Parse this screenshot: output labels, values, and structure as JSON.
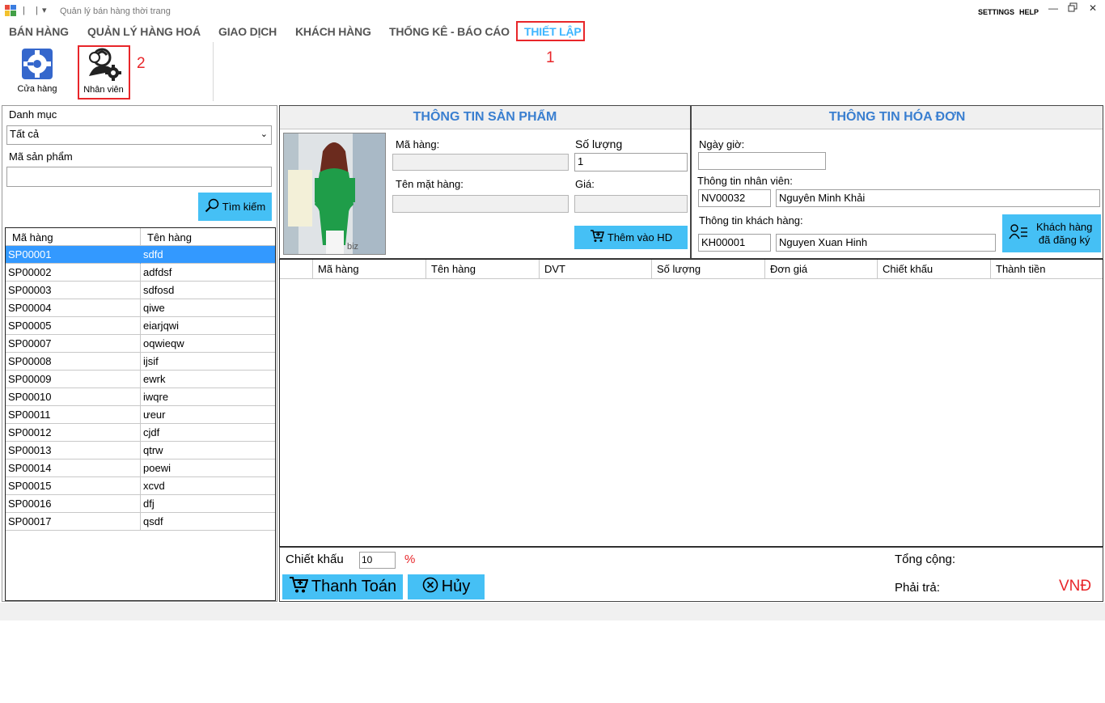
{
  "window": {
    "title": "Quản lý bán hàng thời trang",
    "settings": "SETTINGS",
    "help": "HELP"
  },
  "menu": {
    "tabs": [
      {
        "label": "BÁN HÀNG"
      },
      {
        "label": "QUẢN LÝ HÀNG HOÁ"
      },
      {
        "label": "GIAO DỊCH"
      },
      {
        "label": "KHÁCH HÀNG"
      },
      {
        "label": "THỐNG KÊ - BÁO CÁO"
      },
      {
        "label": "THIẾT LẬP"
      }
    ],
    "active_tab": "THIẾT LẬP"
  },
  "ribbon": {
    "store_label": "Cửa hàng",
    "staff_label": "Nhân viên"
  },
  "annotations": {
    "marker1": "1",
    "marker2": "2",
    "color": "#e8262a"
  },
  "filter": {
    "category_label": "Danh mục",
    "category_value": "Tất cả",
    "product_code_label": "Mã sản phẩm",
    "product_code_value": "",
    "search_button": "Tìm kiếm"
  },
  "product_list": {
    "columns": [
      "Mã hàng",
      "Tên hàng"
    ],
    "rows": [
      {
        "code": "SP00001",
        "name": "sdfd"
      },
      {
        "code": "SP00002",
        "name": "adfdsf"
      },
      {
        "code": "SP00003",
        "name": "sdfosd"
      },
      {
        "code": "SP00004",
        "name": "qiwe"
      },
      {
        "code": "SP00005",
        "name": "eiarjqwi"
      },
      {
        "code": "SP00007",
        "name": "oqwieqw"
      },
      {
        "code": "SP00008",
        "name": "ijsif"
      },
      {
        "code": "SP00009",
        "name": "ewrk"
      },
      {
        "code": "SP00010",
        "name": "iwqre"
      },
      {
        "code": "SP00011",
        "name": "ưeur"
      },
      {
        "code": "SP00012",
        "name": "cjdf"
      },
      {
        "code": "SP00013",
        "name": "qtrw"
      },
      {
        "code": "SP00014",
        "name": "poewi"
      },
      {
        "code": "SP00015",
        "name": "xcvd"
      },
      {
        "code": "SP00016",
        "name": "dfj"
      },
      {
        "code": "SP00017",
        "name": "qsdf"
      }
    ],
    "selected_code": "SP00001"
  },
  "product_info": {
    "header": "THÔNG TIN SẢN PHẨM",
    "code_label": "Mã hàng:",
    "code_value": "",
    "qty_label": "Số lượng",
    "qty_value": "1",
    "name_label": "Tên mặt hàng:",
    "name_value": "",
    "price_label": "Giá:",
    "price_value": "",
    "add_button": "Thêm vào HD",
    "image_caption": "biz"
  },
  "invoice_info": {
    "header": "THÔNG TIN HÓA ĐƠN",
    "datetime_label": "Ngày giờ:",
    "datetime_value": "",
    "staff_label": "Thông tin nhân viên:",
    "staff_id": "NV00032",
    "staff_name": "Nguyên Minh Khải",
    "customer_label": "Thông tin khách hàng:",
    "customer_id": "KH00001",
    "customer_name": "Nguyen Xuan Hinh",
    "registered_button_line1": "Khách hàng",
    "registered_button_line2": "đã đăng ký"
  },
  "invoice_grid": {
    "columns": [
      "",
      "Mã hàng",
      "Tên hàng",
      "DVT",
      "Số lượng",
      "Đơn giá",
      "Chiết khấu",
      "Thành tiền"
    ]
  },
  "totals": {
    "discount_label": "Chiết khấu",
    "discount_value": "10",
    "discount_unit": "%",
    "total_label": "Tổng cộng:",
    "total_value": "",
    "pay_label": "Phải trả:",
    "pay_currency": "VNĐ",
    "checkout_button": "Thanh Toán",
    "cancel_button": "Hủy"
  },
  "colors": {
    "accent_blue": "#45c0f5",
    "selection": "#3399ff",
    "header_text": "#3a7fd0",
    "active_tab": "#3fb6ff",
    "currency_red": "#e8262a"
  }
}
